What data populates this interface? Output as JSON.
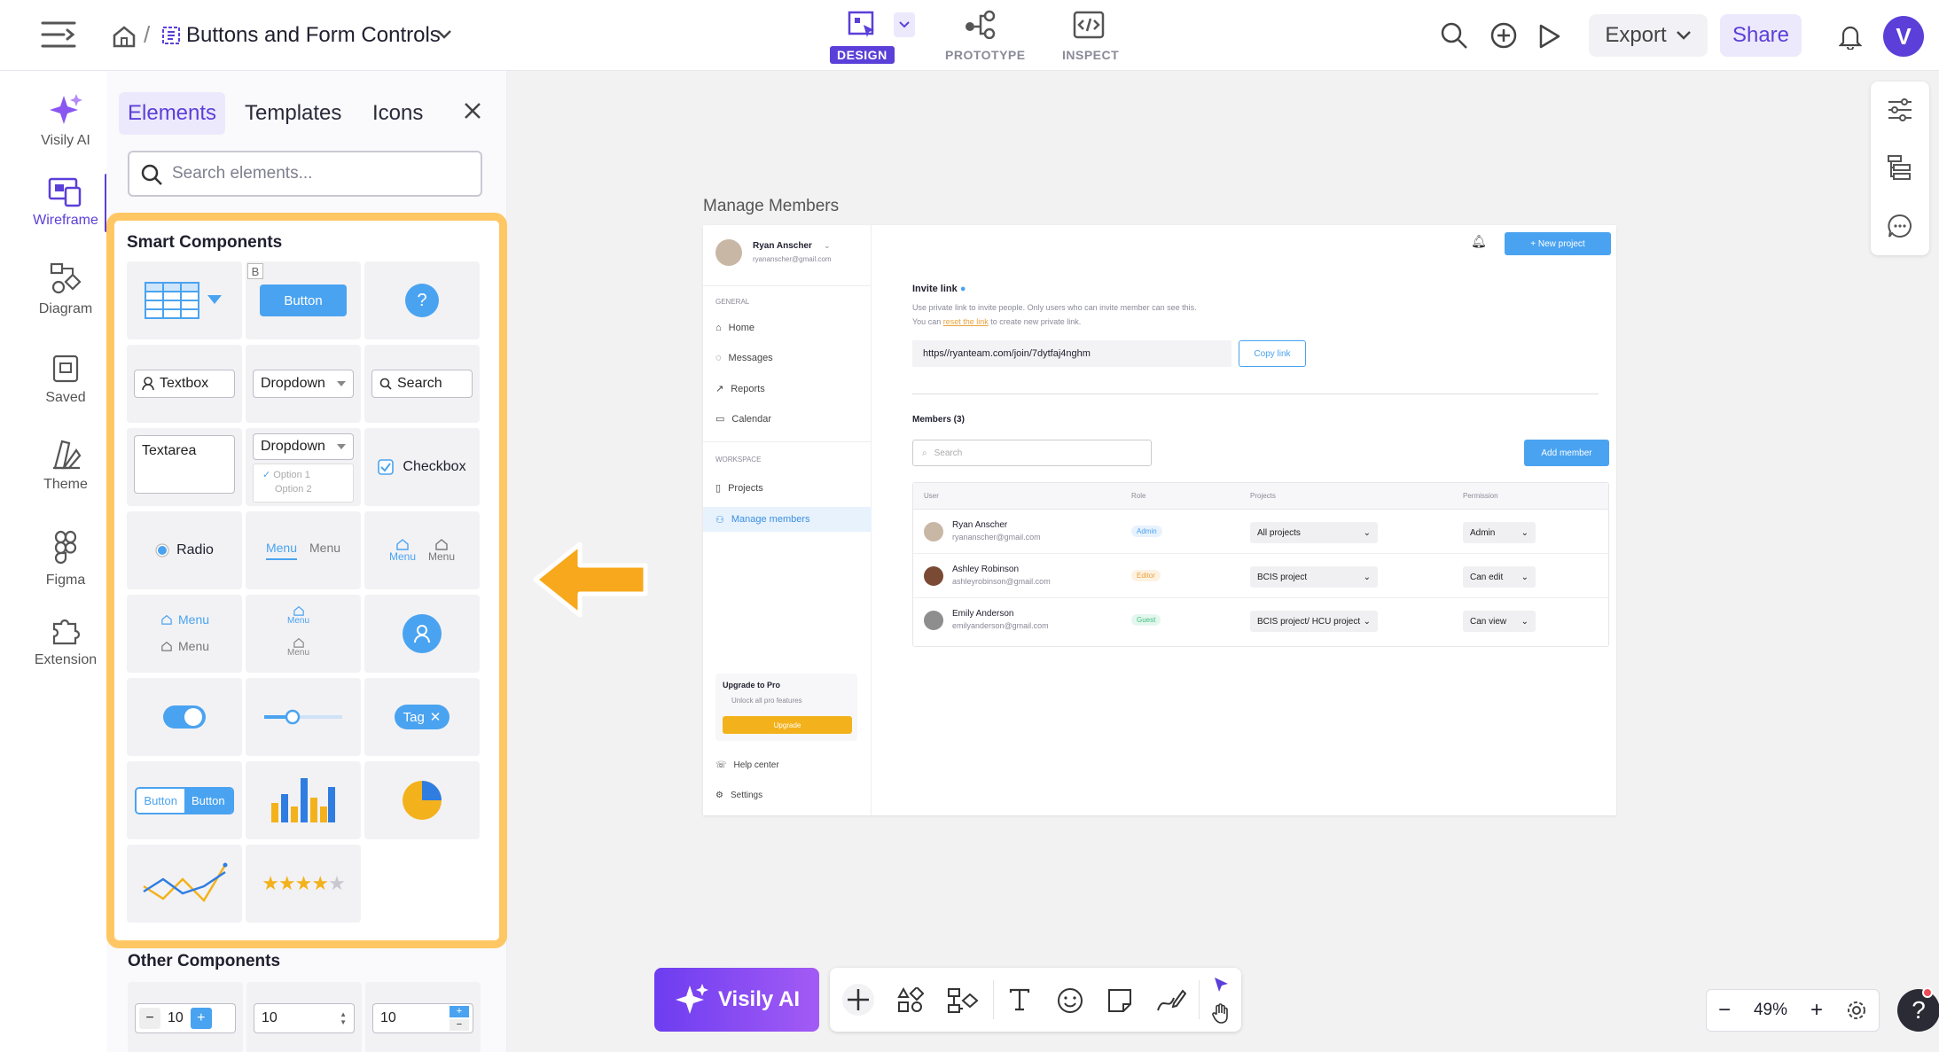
{
  "header": {
    "title": "Buttons and Form Controls",
    "modes": [
      {
        "label": "DESIGN",
        "icon": "design-icon",
        "active": true
      },
      {
        "label": "PROTOTYPE",
        "icon": "prototype-icon",
        "active": false
      },
      {
        "label": "INSPECT",
        "icon": "inspect-icon",
        "active": false
      }
    ],
    "export_label": "Export",
    "share_label": "Share",
    "avatar_letter": "V",
    "accent": "#5b3fd8"
  },
  "leftrail": {
    "items": [
      {
        "label": "Visily AI",
        "icon": "sparkle-icon"
      },
      {
        "label": "Wireframe",
        "icon": "wireframe-icon",
        "active": true
      },
      {
        "label": "Diagram",
        "icon": "diagram-icon"
      },
      {
        "label": "Saved",
        "icon": "saved-icon"
      },
      {
        "label": "Theme",
        "icon": "theme-icon"
      },
      {
        "label": "Figma",
        "icon": "figma-icon"
      },
      {
        "label": "Extension",
        "icon": "extension-icon"
      }
    ]
  },
  "panel": {
    "tabs": [
      "Elements",
      "Templates",
      "Icons"
    ],
    "search_placeholder": "Search elements...",
    "smart_title": "Smart Components",
    "other_title": "Other Components",
    "components": {
      "button": "Button",
      "textbox": "Textbox",
      "dropdown": "Dropdown",
      "search": "Search",
      "textarea": "Textarea",
      "option1": "Option 1",
      "option2": "Option 2",
      "checkbox": "Checkbox",
      "radio": "Radio",
      "menu": "Menu",
      "tag": "Tag",
      "segment_btn": "Button",
      "help_glyph": "?",
      "table_badge": "B"
    },
    "steppers": [
      "10",
      "10",
      "10"
    ]
  },
  "canvas": {
    "frame_label": "Manage Members",
    "mock": {
      "user_name": "Ryan Anscher",
      "user_email": "ryananscher@gmail.com",
      "new_project": "+ New project",
      "nav_general": "GENERAL",
      "nav_items": [
        "Home",
        "Messages",
        "Reports",
        "Calendar"
      ],
      "nav_workspace": "WORKSPACE",
      "nav_items2": [
        "Projects",
        "Manage members"
      ],
      "invite_title": "Invite link",
      "invite_desc1": "Use private link to invite people. Only users who can invite member can see this.",
      "invite_desc2_a": "You can ",
      "invite_desc2_link": "reset the link",
      "invite_desc2_b": " to create new private link.",
      "invite_url": "https//ryanteam.com/join/7dytfaj4nghm",
      "copy_link": "Copy link",
      "members_title": "Members (3)",
      "search_placeholder": "Search",
      "add_member": "Add member",
      "cols": [
        "User",
        "Role",
        "Projects",
        "Permission"
      ],
      "rows": [
        {
          "name": "Ryan Anscher",
          "email": "ryananscher@gmail.com",
          "role": "Admin",
          "role_color": "#4aa3f0",
          "project": "All projects",
          "perm": "Admin"
        },
        {
          "name": "Ashley Robinson",
          "email": "ashleyrobinson@gmail.com",
          "role": "Editor",
          "role_color": "#e9a23b",
          "project": "BCIS project",
          "perm": "Can edit"
        },
        {
          "name": "Emily Anderson",
          "email": "emilyanderson@gmail.com",
          "role": "Guest",
          "role_color": "#3fbf7f",
          "project": "BCIS project/ HCU project",
          "perm": "Can view"
        }
      ],
      "upgrade_title": "Upgrade to Pro",
      "upgrade_sub": "Unlock all pro features",
      "upgrade_btn": "Upgrade",
      "help_center": "Help center",
      "settings": "Settings"
    }
  },
  "bottom": {
    "ai_label": "Visily AI",
    "zoom": "49%"
  }
}
